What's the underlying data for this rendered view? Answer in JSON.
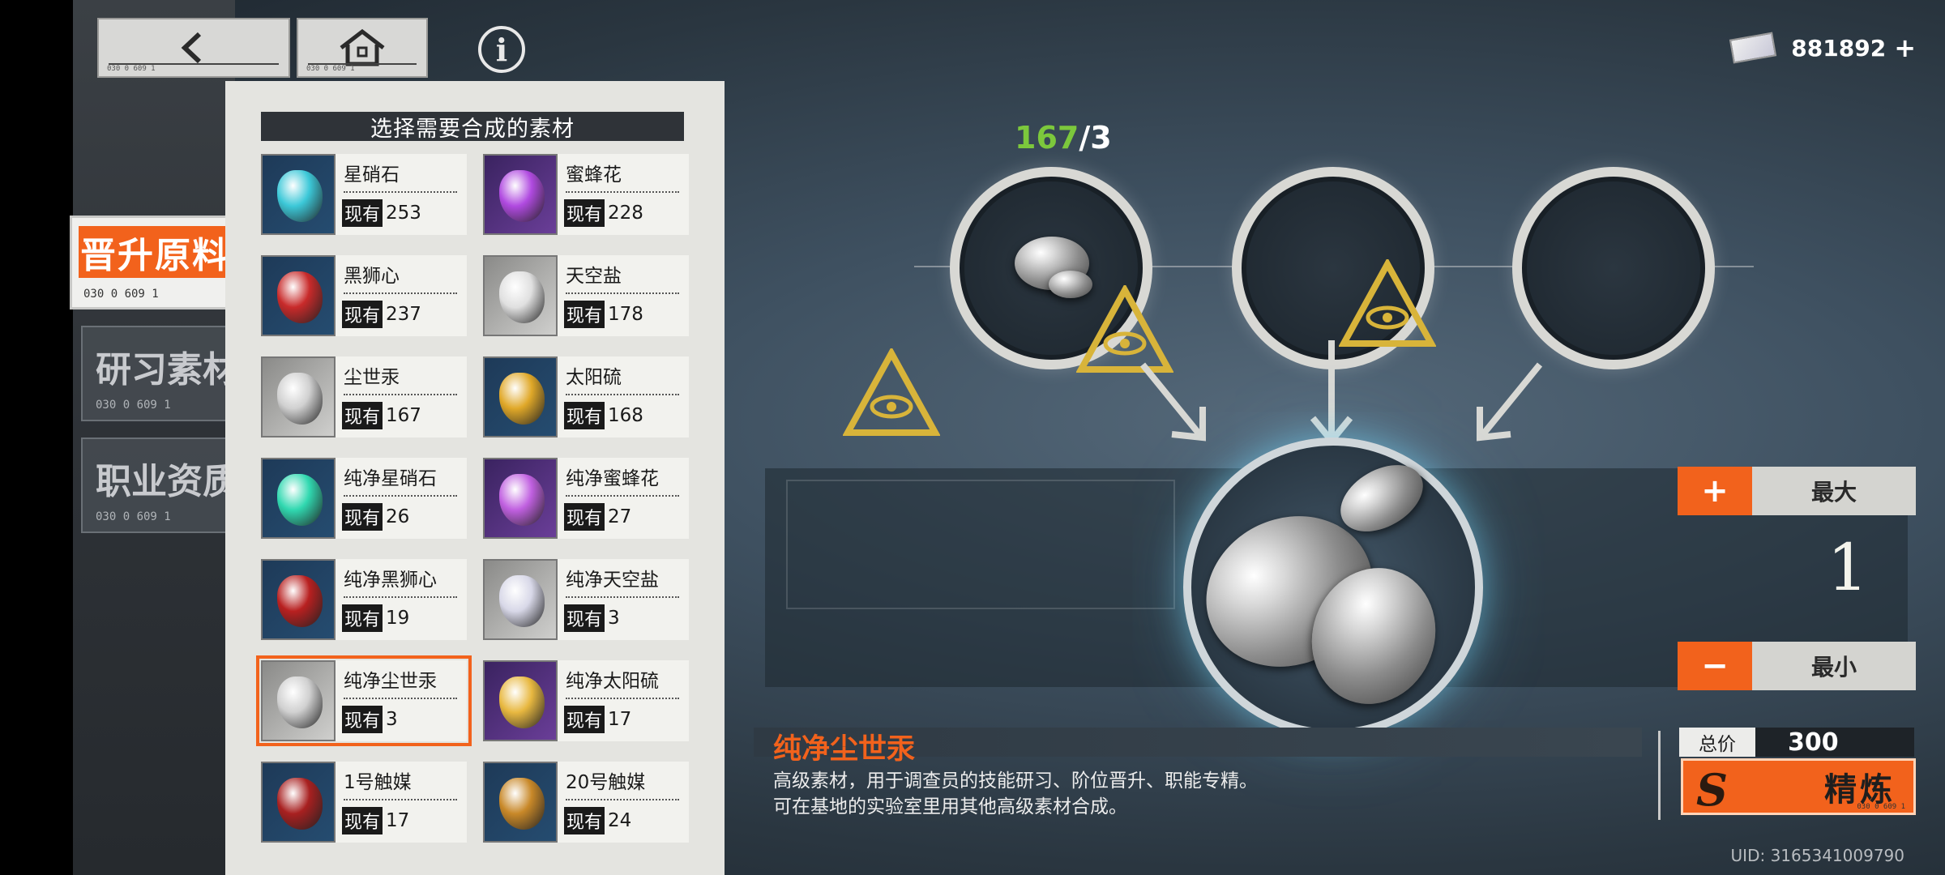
{
  "nav": {
    "back_code": "030 0 609 1",
    "home_code": "030 0 609 1"
  },
  "categories": [
    {
      "label": "晋升原料",
      "code": "030 0 609 1"
    },
    {
      "label": "研习素材",
      "code": "030 0 609 1"
    },
    {
      "label": "职业资质",
      "code": "030 0 609 1"
    }
  ],
  "panel": {
    "title": "选择需要合成的素材",
    "stock_prefix": "现有",
    "items": [
      {
        "name": "星硝石",
        "count": "253"
      },
      {
        "name": "蜜蜂花",
        "count": "228"
      },
      {
        "name": "黑狮心",
        "count": "237"
      },
      {
        "name": "天空盐",
        "count": "178"
      },
      {
        "name": "尘世汞",
        "count": "167"
      },
      {
        "name": "太阳硫",
        "count": "168"
      },
      {
        "name": "纯净星硝石",
        "count": "26"
      },
      {
        "name": "纯净蜜蜂花",
        "count": "27"
      },
      {
        "name": "纯净黑狮心",
        "count": "19"
      },
      {
        "name": "纯净天空盐",
        "count": "3"
      },
      {
        "name": "纯净尘世汞",
        "count": "3",
        "selected": true
      },
      {
        "name": "纯净太阳硫",
        "count": "17"
      },
      {
        "name": "1号触媒",
        "count": "17"
      },
      {
        "name": "20号触媒",
        "count": "24"
      }
    ]
  },
  "currency": {
    "amount": "881892",
    "plus": "+"
  },
  "synthesis": {
    "have": "167",
    "need": "/3"
  },
  "quantity": {
    "plus_symbol": "+",
    "max_label": "最大",
    "value": "1",
    "minus_symbol": "−",
    "min_label": "最小"
  },
  "item": {
    "name": "纯净尘世汞",
    "desc_line1": "高级素材，用于调查员的技能研习、阶位晋升、职能专精。",
    "desc_line2": "可在基地的实验室里用其他高级素材合成。"
  },
  "price": {
    "label": "总价",
    "value": "300"
  },
  "craft": {
    "label": "精炼",
    "code": "030 0 609 1"
  },
  "uid": "UID: 3165341009790",
  "colors": {
    "accent": "#f2621c",
    "have_green": "#7cc83c"
  }
}
